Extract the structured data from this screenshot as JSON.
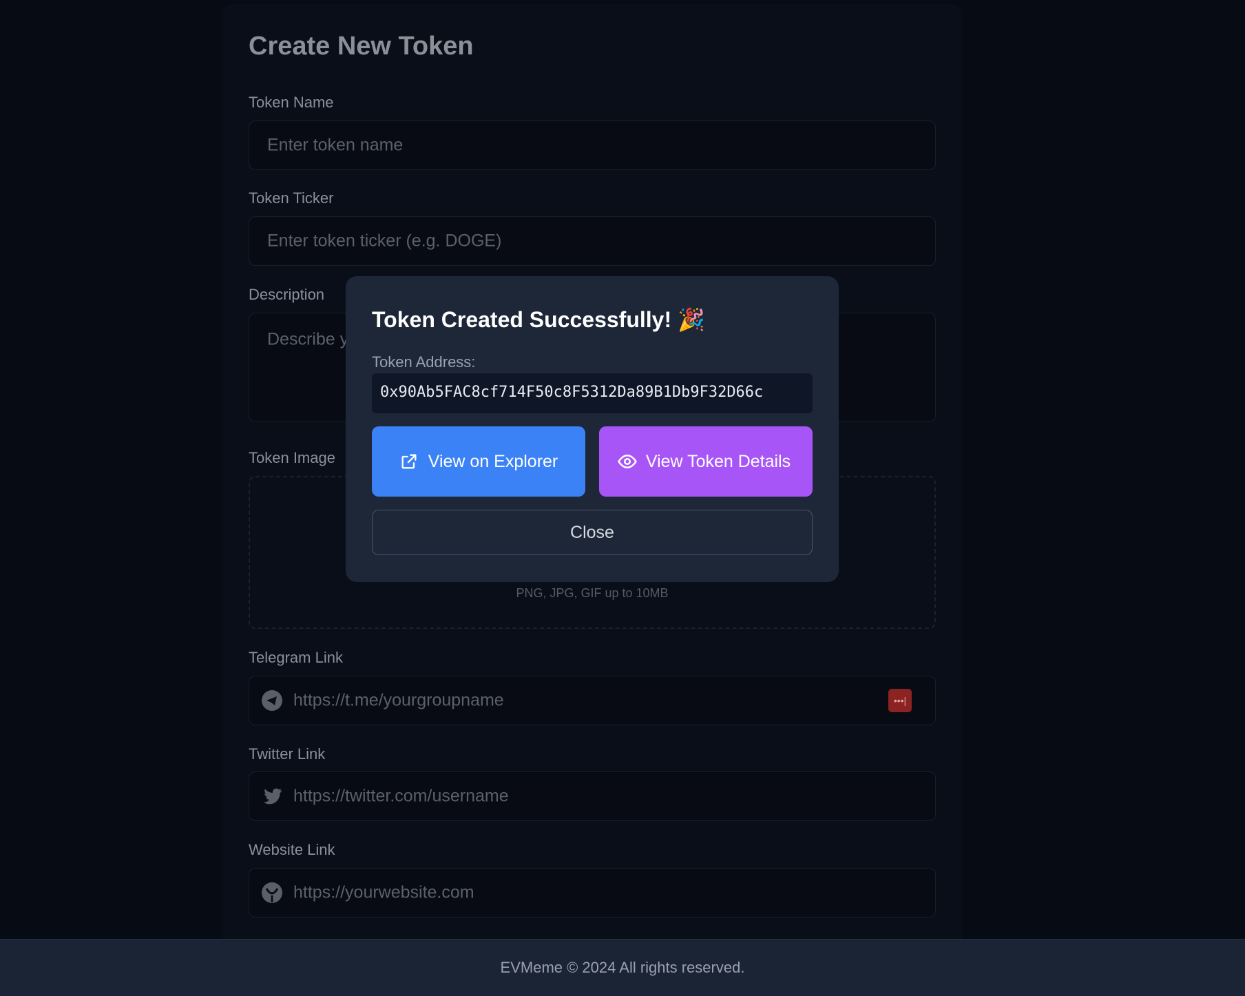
{
  "form": {
    "title": "Create New Token",
    "token_name": {
      "label": "Token Name",
      "placeholder": "Enter token name"
    },
    "token_ticker": {
      "label": "Token Ticker",
      "placeholder": "Enter token ticker (e.g. DOGE)"
    },
    "description": {
      "label": "Description",
      "placeholder": "Describe your token"
    },
    "token_image": {
      "label": "Token Image",
      "hint": "PNG, JPG, GIF up to 10MB"
    },
    "telegram": {
      "label": "Telegram Link",
      "placeholder": "https://t.me/yourgroupname",
      "icon": "telegram-icon"
    },
    "twitter": {
      "label": "Twitter Link",
      "placeholder": "https://twitter.com/username",
      "icon": "twitter-icon"
    },
    "website": {
      "label": "Website Link",
      "placeholder": "https://yourwebsite.com",
      "icon": "globe-icon"
    }
  },
  "modal": {
    "title": "Token Created Successfully! 🎉",
    "address_label": "Token Address:",
    "address": "0x90Ab5FAC8cf714F50c8F5312Da89B1Db9F32D66c",
    "explorer_label": "View on Explorer",
    "details_label": "View Token Details",
    "close_label": "Close",
    "colors": {
      "explorer": "#3b82f6",
      "details": "#a855f7"
    }
  },
  "footer": {
    "text": "EVMeme © 2024 All rights reserved."
  }
}
